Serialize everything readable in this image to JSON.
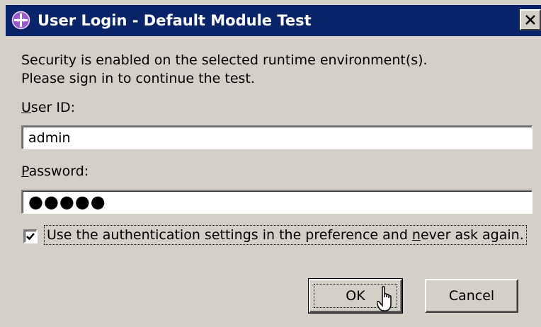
{
  "window": {
    "title": "User Login - Default Module Test",
    "icon": "gear-module-icon",
    "close_icon": "close-icon",
    "titlebar_color": "#0a246a"
  },
  "message": {
    "line1": "Security is enabled on the selected runtime environment(s).",
    "line2": "Please sign in to continue the test."
  },
  "user_id": {
    "label": "User ID:",
    "value": "admin"
  },
  "password": {
    "label": "Password:",
    "value": "●●●●●"
  },
  "remember": {
    "checked": true,
    "label": "Use the authentication settings in the preference and never ask again."
  },
  "buttons": {
    "ok": "OK",
    "cancel": "Cancel"
  }
}
